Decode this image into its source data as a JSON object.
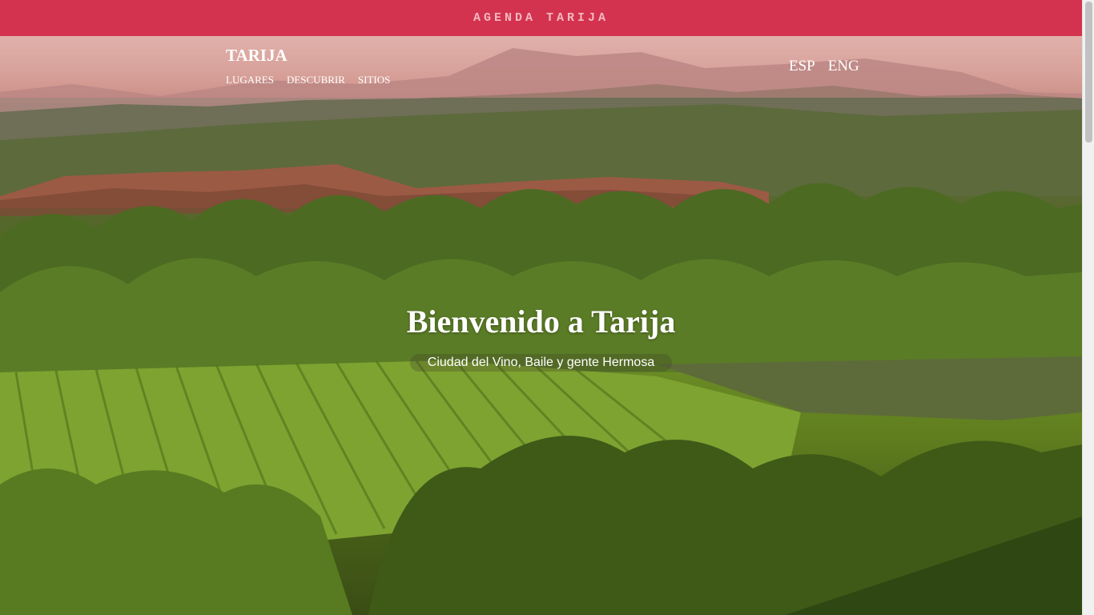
{
  "topbar": {
    "title": "AGENDA TARIJA"
  },
  "nav": {
    "brand": "TARIJA",
    "links": [
      "LUGARES",
      "DESCUBRIR",
      "SITIOS"
    ],
    "languages": [
      "ESP",
      "ENG"
    ]
  },
  "hero": {
    "title": "Bienvenido a Tarija",
    "subtitle": "Ciudad del Vino, Baile y gente Hermosa"
  },
  "colors": {
    "topbar_bg": "#d3334f",
    "topbar_text": "#f4b8c0",
    "nav_overlay": "#d68c8c"
  }
}
